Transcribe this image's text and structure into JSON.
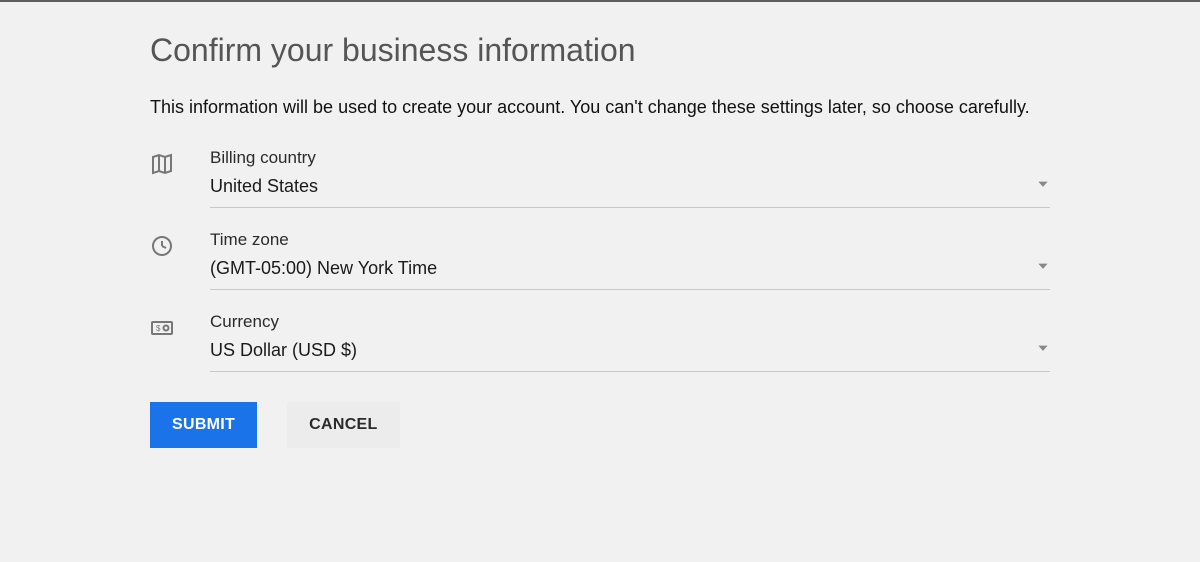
{
  "heading": "Confirm your business information",
  "description": "This information will be used to create your account. You can't change these settings later, so choose carefully.",
  "fields": {
    "billing_country": {
      "label": "Billing country",
      "value": "United States"
    },
    "time_zone": {
      "label": "Time zone",
      "value": "(GMT-05:00) New York Time"
    },
    "currency": {
      "label": "Currency",
      "value": "US Dollar (USD $)"
    }
  },
  "buttons": {
    "submit": "SUBMIT",
    "cancel": "CANCEL"
  }
}
